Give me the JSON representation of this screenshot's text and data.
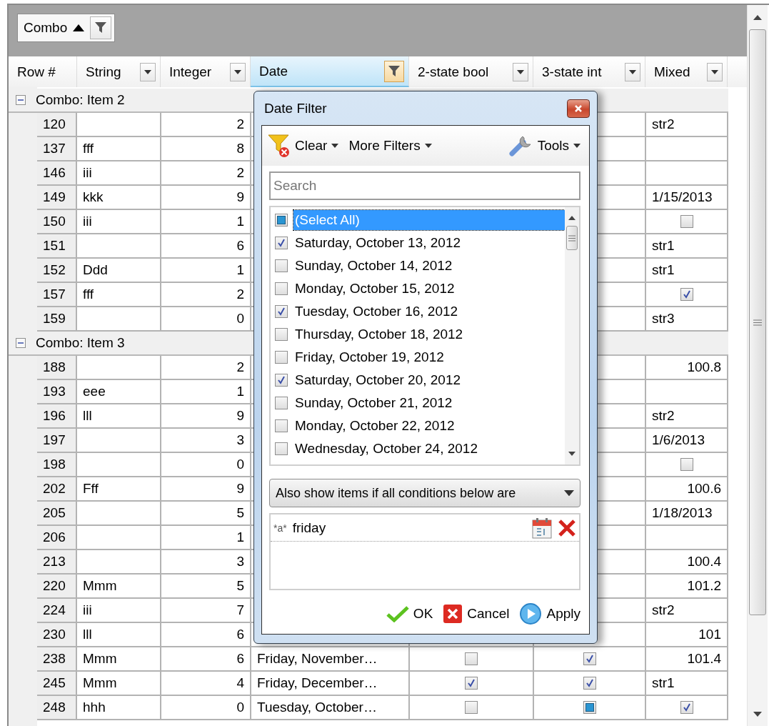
{
  "group_panel": {
    "chips": [
      {
        "label": "Combo",
        "sort_ascending": true
      }
    ]
  },
  "columns": [
    {
      "label": "Row #",
      "has_filter": false,
      "filtered": false
    },
    {
      "label": "String",
      "has_filter": true,
      "filtered": false
    },
    {
      "label": "Integer",
      "has_filter": true,
      "filtered": false
    },
    {
      "label": "Date",
      "has_filter": true,
      "filtered": true
    },
    {
      "label": "2-state bool",
      "has_filter": true,
      "filtered": false
    },
    {
      "label": "3-state int",
      "has_filter": true,
      "filtered": false
    },
    {
      "label": "Mixed",
      "has_filter": true,
      "filtered": false
    }
  ],
  "groups": [
    {
      "label": "Combo: Item 2",
      "expanded": true,
      "rows": [
        {
          "row": "120",
          "integer": "2",
          "mixed": {
            "kind": "text",
            "value": "str2"
          }
        },
        {
          "row": "137",
          "string": "fff",
          "integer": "8"
        },
        {
          "row": "146",
          "string": "iii",
          "integer": "2"
        },
        {
          "row": "149",
          "string": "kkk",
          "integer": "9",
          "mixed": {
            "kind": "text",
            "value": "1/15/2013"
          }
        },
        {
          "row": "150",
          "string": "iii",
          "integer": "1",
          "mixed": {
            "kind": "check",
            "checked": false
          }
        },
        {
          "row": "151",
          "integer": "6",
          "mixed": {
            "kind": "text",
            "value": "str1"
          }
        },
        {
          "row": "152",
          "string": "Ddd",
          "integer": "1",
          "mixed": {
            "kind": "text",
            "value": "str1"
          }
        },
        {
          "row": "157",
          "string": "fff",
          "integer": "2",
          "mixed": {
            "kind": "check",
            "checked": true
          }
        },
        {
          "row": "159",
          "integer": "0",
          "mixed": {
            "kind": "text",
            "value": "str3"
          }
        }
      ]
    },
    {
      "label": "Combo: Item 3",
      "expanded": true,
      "rows": [
        {
          "row": "188",
          "integer": "2",
          "mixed": {
            "kind": "number",
            "value": "100.8"
          }
        },
        {
          "row": "193",
          "string": "eee",
          "integer": "1"
        },
        {
          "row": "196",
          "string": "lll",
          "integer": "9",
          "mixed": {
            "kind": "text",
            "value": "str2"
          }
        },
        {
          "row": "197",
          "integer": "3",
          "mixed": {
            "kind": "text",
            "value": "1/6/2013"
          }
        },
        {
          "row": "198",
          "integer": "0",
          "mixed": {
            "kind": "check",
            "checked": false
          }
        },
        {
          "row": "202",
          "string": "Fff",
          "integer": "9",
          "mixed": {
            "kind": "number",
            "value": "100.6"
          }
        },
        {
          "row": "205",
          "integer": "5",
          "mixed": {
            "kind": "text",
            "value": "1/18/2013"
          }
        },
        {
          "row": "206",
          "integer": "1"
        },
        {
          "row": "213",
          "integer": "3",
          "mixed": {
            "kind": "number",
            "value": "100.4"
          }
        },
        {
          "row": "220",
          "string": "Mmm",
          "integer": "5",
          "mixed": {
            "kind": "number",
            "value": "101.2"
          }
        },
        {
          "row": "224",
          "string": "iii",
          "integer": "7",
          "mixed": {
            "kind": "text",
            "value": "str2"
          }
        },
        {
          "row": "230",
          "string": "lll",
          "integer": "6",
          "mixed": {
            "kind": "number",
            "value": "101"
          }
        },
        {
          "row": "238",
          "string": "Mmm",
          "integer": "6",
          "date": "Friday, November…",
          "bool": false,
          "tristate": {
            "checked": true,
            "partial": false
          },
          "mixed": {
            "kind": "number",
            "value": "101.4"
          }
        },
        {
          "row": "245",
          "string": "Mmm",
          "integer": "4",
          "date": "Friday, December…",
          "bool": true,
          "tristate": {
            "checked": true,
            "partial": false
          },
          "mixed": {
            "kind": "text",
            "value": "str1"
          }
        },
        {
          "row": "248",
          "string": "hhh",
          "integer": "0",
          "date": "Tuesday, October…",
          "bool": false,
          "tristate": {
            "checked": false,
            "partial": true
          },
          "mixed": {
            "kind": "check",
            "checked": true
          }
        }
      ]
    }
  ],
  "filter_popup": {
    "title": "Date Filter",
    "toolbar": {
      "clear": "Clear",
      "more_filters": "More Filters",
      "tools": "Tools"
    },
    "search": {
      "placeholder": "Search"
    },
    "values": [
      {
        "label": "(Select All)",
        "checked": false,
        "partial": true,
        "selected": true
      },
      {
        "label": "Saturday, October 13, 2012",
        "checked": true,
        "partial": false,
        "selected": false
      },
      {
        "label": "Sunday, October 14, 2012",
        "checked": false,
        "partial": false,
        "selected": false
      },
      {
        "label": "Monday, October 15, 2012",
        "checked": false,
        "partial": false,
        "selected": false
      },
      {
        "label": "Tuesday, October 16, 2012",
        "checked": true,
        "partial": false,
        "selected": false
      },
      {
        "label": "Thursday, October 18, 2012",
        "checked": false,
        "partial": false,
        "selected": false
      },
      {
        "label": "Friday, October 19, 2012",
        "checked": false,
        "partial": false,
        "selected": false
      },
      {
        "label": "Saturday, October 20, 2012",
        "checked": true,
        "partial": false,
        "selected": false
      },
      {
        "label": "Sunday, October 21, 2012",
        "checked": false,
        "partial": false,
        "selected": false
      },
      {
        "label": "Monday, October 22, 2012",
        "checked": false,
        "partial": false,
        "selected": false
      },
      {
        "label": "Wednesday, October 24, 2012",
        "checked": false,
        "partial": false,
        "selected": false
      }
    ],
    "mode": "Also show items if all conditions below are",
    "conditions": [
      {
        "operator": "*a*",
        "value": "friday"
      }
    ],
    "buttons": {
      "ok": "OK",
      "cancel": "Cancel",
      "apply": "Apply"
    }
  }
}
